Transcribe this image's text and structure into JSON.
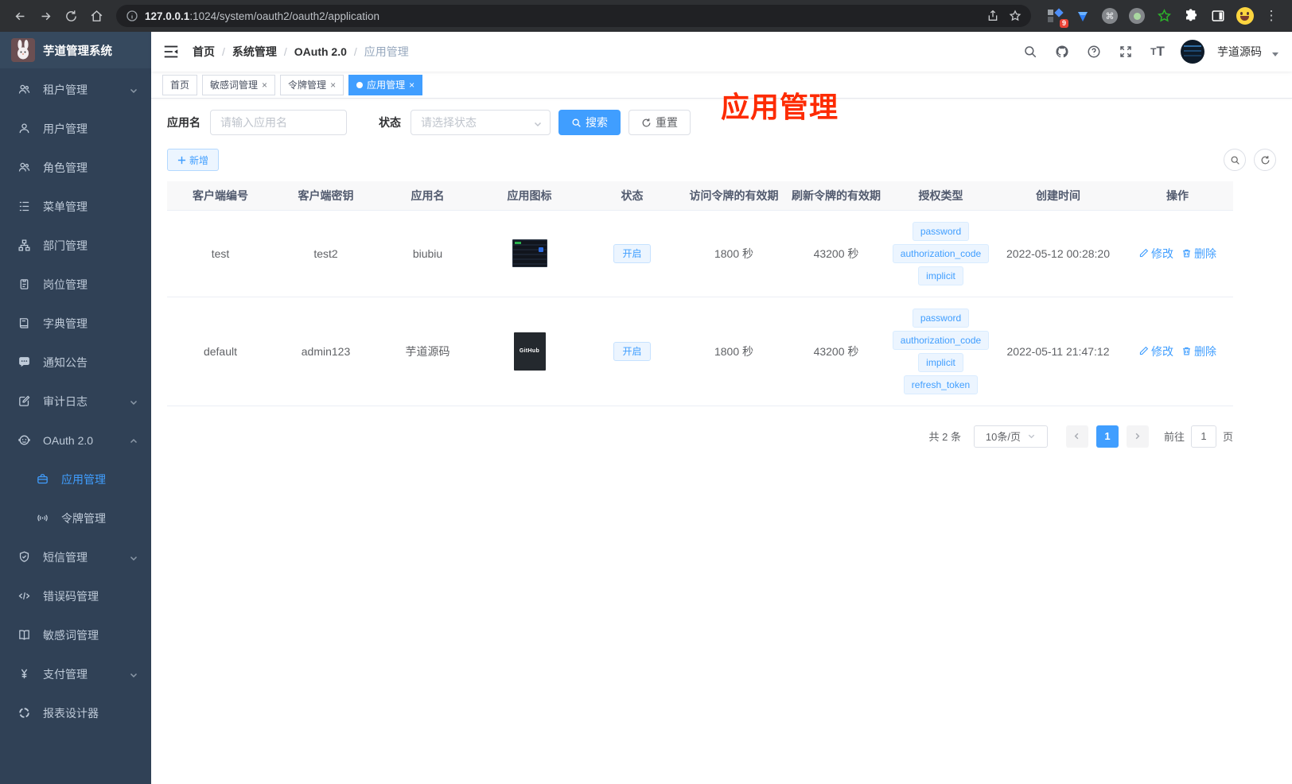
{
  "browser": {
    "url_host": "127.0.0.1",
    "url_rest": ":1024/system/oauth2/oauth2/application",
    "ext_badge": "9"
  },
  "sidebar": {
    "title": "芋道管理系统",
    "items": [
      {
        "label": "租户管理",
        "icon": "tenant-icon"
      },
      {
        "label": "用户管理",
        "icon": "user-icon"
      },
      {
        "label": "角色管理",
        "icon": "role-icon"
      },
      {
        "label": "菜单管理",
        "icon": "menu-tree-icon"
      },
      {
        "label": "部门管理",
        "icon": "org-icon"
      },
      {
        "label": "岗位管理",
        "icon": "post-icon"
      },
      {
        "label": "字典管理",
        "icon": "dictionary-icon"
      },
      {
        "label": "通知公告",
        "icon": "announcement-icon"
      },
      {
        "label": "审计日志",
        "icon": "audit-icon"
      },
      {
        "label": "OAuth 2.0",
        "icon": "oauth-icon"
      },
      {
        "label": "应用管理",
        "icon": "application-icon"
      },
      {
        "label": "令牌管理",
        "icon": "token-icon"
      },
      {
        "label": "短信管理",
        "icon": "sms-icon"
      },
      {
        "label": "错误码管理",
        "icon": "error-code-icon"
      },
      {
        "label": "敏感词管理",
        "icon": "sensitive-word-icon"
      },
      {
        "label": "支付管理",
        "icon": "pay-icon"
      },
      {
        "label": "报表设计器",
        "icon": "report-icon"
      }
    ]
  },
  "header": {
    "breadcrumb": [
      "首页",
      "系统管理",
      "OAuth 2.0",
      "应用管理"
    ],
    "username": "芋道源码"
  },
  "tags_view": {
    "tabs": [
      {
        "label": "首页"
      },
      {
        "label": "敏感词管理"
      },
      {
        "label": "令牌管理"
      },
      {
        "label": "应用管理"
      }
    ]
  },
  "annotation": {
    "text": "应用管理",
    "color": "#fd2b02"
  },
  "filter": {
    "name_label": "应用名",
    "name_placeholder": "请输入应用名",
    "status_label": "状态",
    "status_placeholder": "请选择状态",
    "search_label": "搜索",
    "reset_label": "重置",
    "add_label": "新增"
  },
  "table": {
    "columns": [
      "客户端编号",
      "客户端密钥",
      "应用名",
      "应用图标",
      "状态",
      "访问令牌的有效期",
      "刷新令牌的有效期",
      "授权类型",
      "创建时间",
      "操作"
    ],
    "actions": {
      "edit": "修改",
      "delete": "删除"
    },
    "rows": [
      {
        "client_id": "test",
        "secret": "test2",
        "name": "biubiu",
        "status": "开启",
        "access_ttl": "1800 秒",
        "refresh_ttl": "43200 秒",
        "grant_types": [
          "password",
          "authorization_code",
          "implicit"
        ],
        "created": "2022-05-12 00:28:20"
      },
      {
        "client_id": "default",
        "secret": "admin123",
        "name": "芋道源码",
        "status": "开启",
        "access_ttl": "1800 秒",
        "refresh_ttl": "43200 秒",
        "grant_types": [
          "password",
          "authorization_code",
          "implicit",
          "refresh_token"
        ],
        "created": "2022-05-11 21:47:12",
        "icon_label": "GitHub"
      }
    ]
  },
  "pagination": {
    "total": "共 2 条",
    "page_size": "10条/页",
    "current_page": "1",
    "goto_label": "前往",
    "goto_value": "1",
    "page_suffix": "页"
  },
  "colors": {
    "accent": "#409eff",
    "sidebar_bg": "#304156",
    "annotation_red": "#fd2b02"
  }
}
